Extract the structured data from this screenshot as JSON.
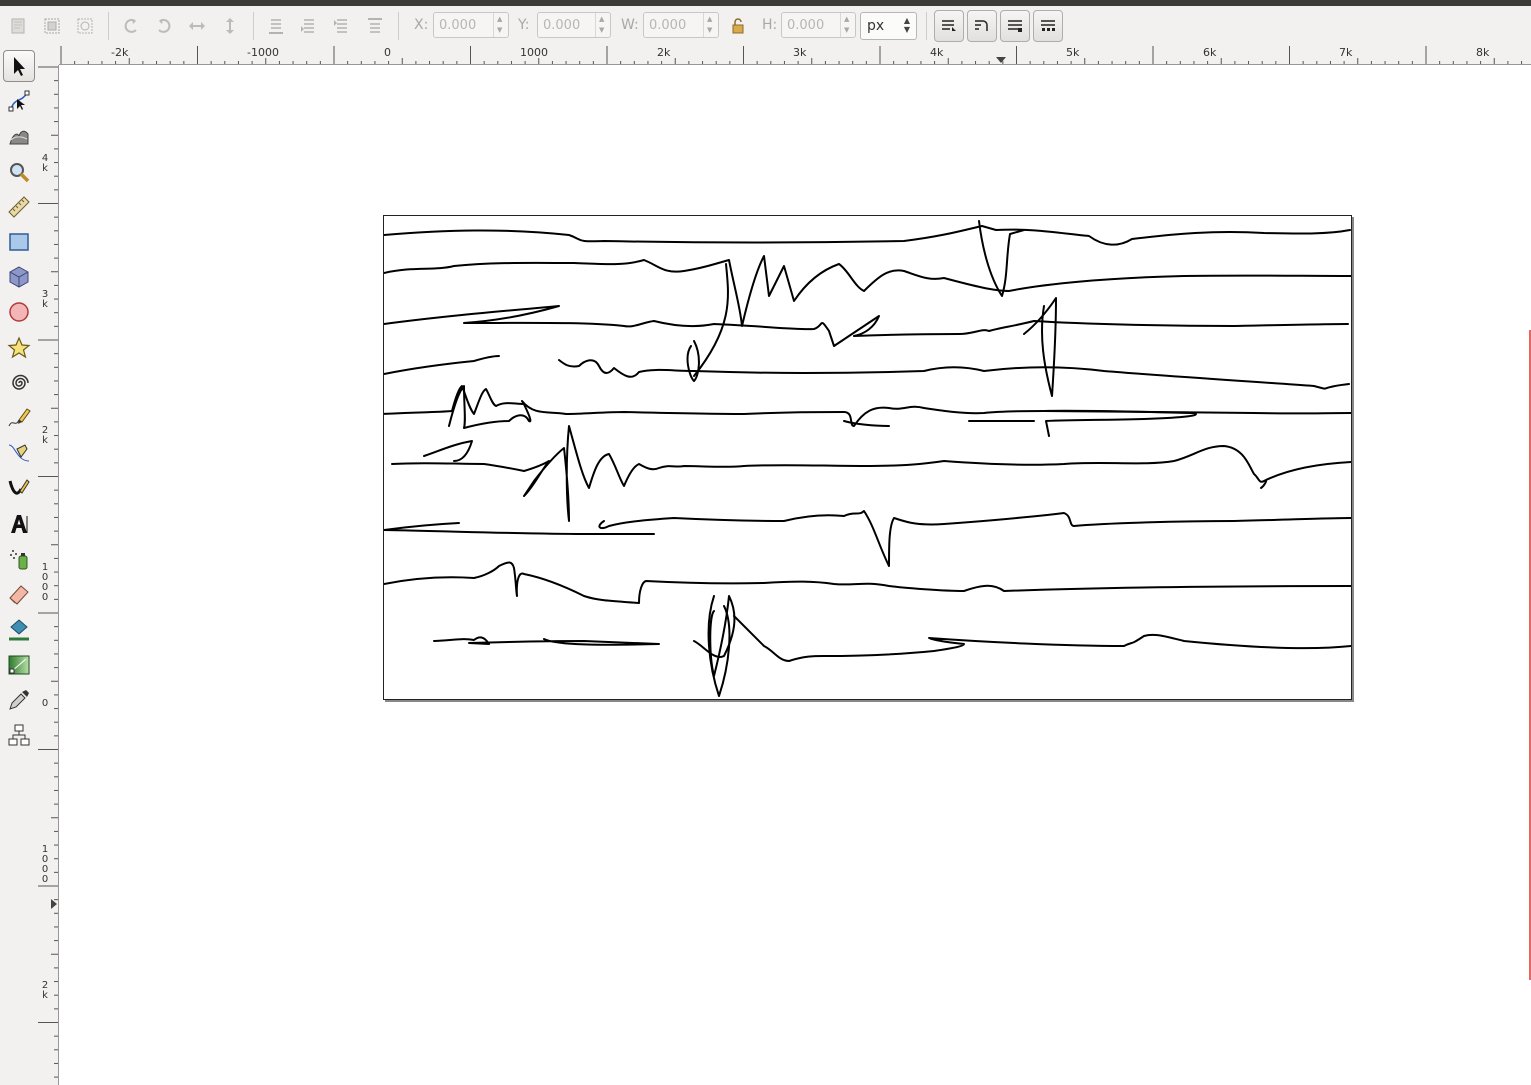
{
  "toolbar": {
    "x_label": "X:",
    "y_label": "Y:",
    "w_label": "W:",
    "h_label": "H:",
    "x_value": "0.000",
    "y_value": "0.000",
    "w_value": "0.000",
    "h_value": "0.000",
    "unit": "px"
  },
  "rulers": {
    "horizontal": [
      "-2k",
      "-1000",
      "0",
      "1000",
      "2k",
      "3k",
      "4k",
      "5k",
      "6k",
      "7k",
      "8k"
    ],
    "vertical": [
      {
        "d1": "4",
        "d2": "k"
      },
      {
        "d1": "3",
        "d2": "k"
      },
      {
        "d1": "2",
        "d2": "k"
      },
      {
        "d1": "1",
        "d2": "0",
        "d3": "0",
        "d4": "0"
      },
      {
        "d1": "0"
      },
      {
        "d1": "1",
        "d2": "0",
        "d3": "0",
        "d4": "0"
      },
      {
        "d1": "2",
        "d2": "k"
      }
    ]
  },
  "colors": {
    "accent_indicator": "#e06a63",
    "stroke": "#000000"
  }
}
